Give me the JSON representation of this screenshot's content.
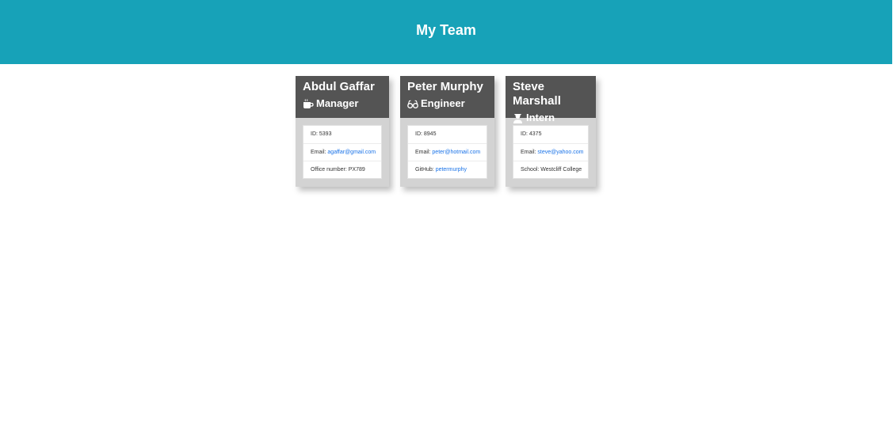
{
  "header": {
    "title": "My Team"
  },
  "cards": [
    {
      "name": "Abdul Gaffar",
      "role": "Manager",
      "role_icon": "mug-icon",
      "id_label": "ID: ",
      "id": "5393",
      "email_label": "Email: ",
      "email": "agaffar@gmail.com",
      "extra_label": "Office number: ",
      "extra": "PX789"
    },
    {
      "name": "Peter Murphy",
      "role": "Engineer",
      "role_icon": "glasses-icon",
      "id_label": "ID: ",
      "id": "8945",
      "email_label": "Email: ",
      "email": "peter@hotmail.com",
      "extra_label": "GitHub: ",
      "extra": "petermurphy"
    },
    {
      "name": "Steve Marshall",
      "role": "Intern",
      "role_icon": "graduate-icon",
      "id_label": "ID: ",
      "id": "4375",
      "email_label": "Email: ",
      "email": "steve@yahoo.com",
      "extra_label": "School: ",
      "extra": "Westcliff College"
    }
  ],
  "colors": {
    "header_bg": "#17a2b8",
    "card_head_bg": "#545454",
    "card_body_bg": "#d3d3d3",
    "link": "#1a73e8"
  }
}
